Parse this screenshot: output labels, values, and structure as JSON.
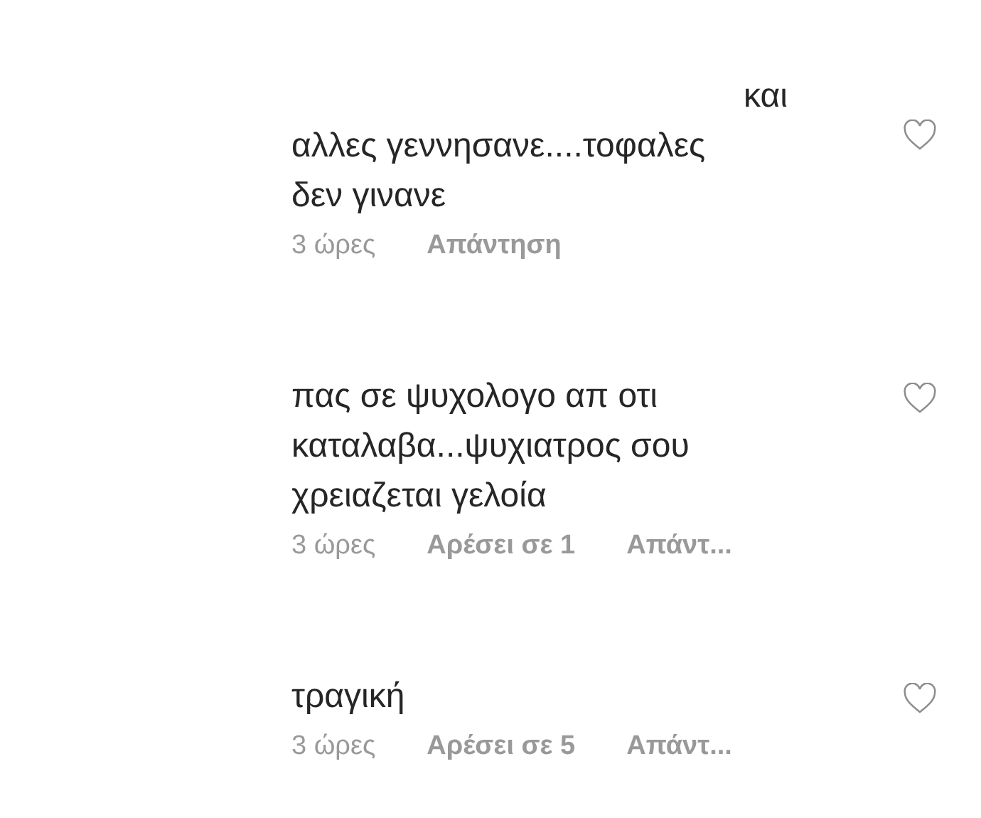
{
  "comments": [
    {
      "text": "και\nαλλες γεννησανε....τοφαλες\nδεν γινανε",
      "time": "3 ώρες",
      "reply": "Απάντηση"
    },
    {
      "text": "πας σε ψυχολογο απ οτι\nκαταλαβα...ψυχιατρος σου\nχρειαζεται γελοία",
      "time": "3 ώρες",
      "likes": "Αρέσει σε 1",
      "reply": "Απάντ..."
    },
    {
      "text": "τραγική",
      "time": "3 ώρες",
      "likes": "Αρέσει σε 5",
      "reply": "Απάντ..."
    }
  ]
}
